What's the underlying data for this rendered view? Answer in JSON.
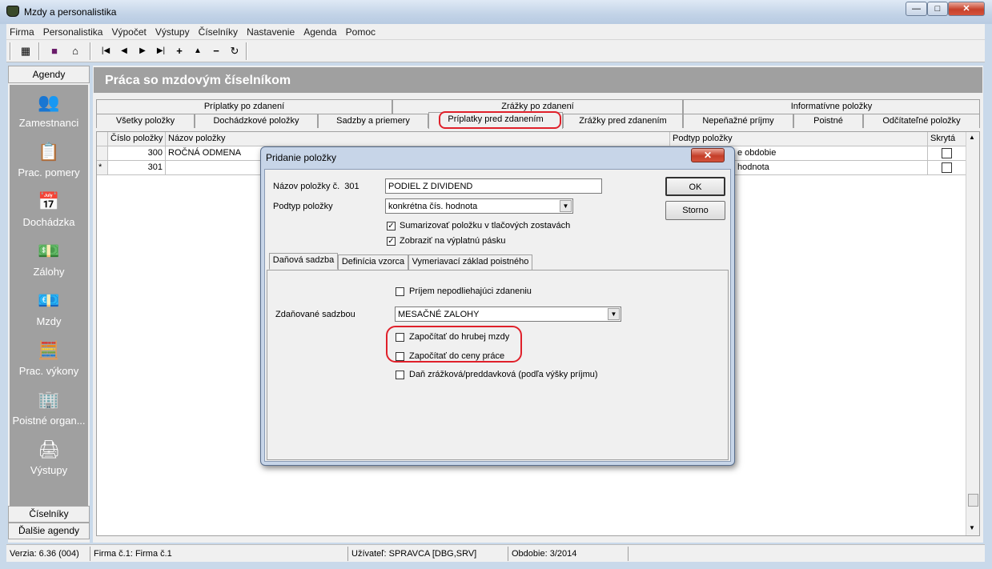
{
  "window": {
    "title": "Mzdy a personalistika",
    "minimize": "—",
    "maximize": "□",
    "close": "✕"
  },
  "menu": [
    "Firma",
    "Personalistika",
    "Výpočet",
    "Výstupy",
    "Číselníky",
    "Nastavenie",
    "Agenda",
    "Pomoc"
  ],
  "toolbar": {
    "icons": [
      "calculator-icon",
      "book-icon",
      "home-icon",
      "first-record-icon",
      "prev-record-icon",
      "next-record-icon",
      "last-record-icon",
      "add-record-icon",
      "up-icon",
      "remove-record-icon",
      "refresh-icon"
    ]
  },
  "sidebar": {
    "header": "Agendy",
    "items": [
      {
        "label": "Zamestnanci",
        "icon": "people-icon"
      },
      {
        "label": "Prac. pomery",
        "icon": "contract-icon"
      },
      {
        "label": "Dochádzka",
        "icon": "calendar-clock-icon"
      },
      {
        "label": "Zálohy",
        "icon": "money-hand-icon"
      },
      {
        "label": "Mzdy",
        "icon": "banknotes-icon"
      },
      {
        "label": "Prac. výkony",
        "icon": "calculator-icon"
      },
      {
        "label": "Poistné organ...",
        "icon": "building-icon"
      },
      {
        "label": "Výstupy",
        "icon": "printer-icon"
      }
    ],
    "footer1": "Číselníky",
    "footer2": "Ďalšie agendy"
  },
  "main": {
    "title": "Práca so mzdovým číselníkom",
    "tabs_row1": [
      "Príplatky po zdanení",
      "Zrážky po zdanení",
      "Informatívne položky"
    ],
    "tabs_row2": [
      "Všetky položky",
      "Dochádzkové položky",
      "Sadzby a priemery",
      "Príplatky pred zdanením",
      "Zrážky pred zdanením",
      "Nepeňažné príjmy",
      "Poistné",
      "Odčítateľné položky"
    ],
    "grid": {
      "headers": [
        "Číslo položky",
        "Názov položky",
        "Podtyp položky",
        "Skrytá"
      ],
      "rows": [
        {
          "marker": "",
          "cislo": "300",
          "nazov": "ROČNÁ ODMENA",
          "podtyp": "e obdobie",
          "skryta": false
        },
        {
          "marker": "*",
          "cislo": "301",
          "nazov": "",
          "podtyp": "hodnota",
          "skryta": false
        }
      ]
    }
  },
  "dialog": {
    "title": "Pridanie položky",
    "close": "✕",
    "nazov_label": "Názov položky č.",
    "cislo": "301",
    "nazov_value": "PODIEL Z DIVIDEND",
    "podtyp_label": "Podtyp položky",
    "podtyp_value": "konkrétna čís. hodnota",
    "sumarizovat": {
      "label": "Sumarizovať položku v tlačových zostavách",
      "checked": true
    },
    "zobrazit": {
      "label": "Zobraziť na výplatnú pásku",
      "checked": true
    },
    "ok": "OK",
    "storno": "Storno",
    "tabs": [
      "Daňová sadzba",
      "Definícia vzorca",
      "Vymeriavací základ poistného"
    ],
    "prijem": {
      "label": "Príjem nepodliehajúci zdaneniu",
      "checked": false
    },
    "zdanovane_label": "Zdaňované sadzbou",
    "zdanovane_value": "MESAČNÉ ZALOHY",
    "hruba_mzda": {
      "label": "Započítať do hrubej mzdy",
      "checked": false
    },
    "cena_prace": {
      "label": "Započítať do ceny práce",
      "checked": false
    },
    "dan_zrazkova": {
      "label": "Daň zrážková/preddavková (podľa výšky príjmu)",
      "checked": false
    }
  },
  "status": {
    "verzia": "Verzia: 6.36 (004)",
    "firma": "Firma č.1: Firma č.1",
    "uzivatel": "Užívateľ: SPRAVCA [DBG,SRV]",
    "obdobie": "Obdobie: 3/2014"
  },
  "colors": {
    "highlight": "#e0202a",
    "header_gray": "#a0a0a0"
  }
}
